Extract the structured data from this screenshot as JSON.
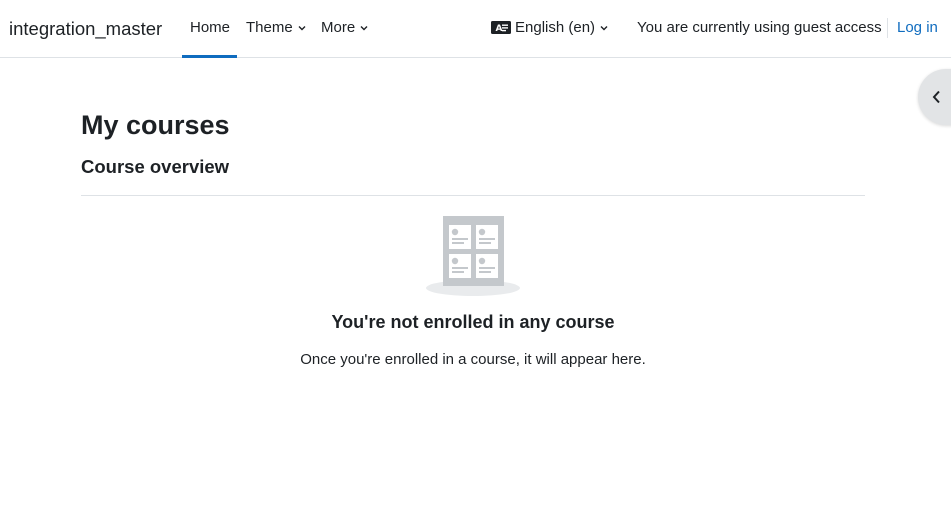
{
  "header": {
    "site_name": "integration_master",
    "nav": {
      "home": "Home",
      "theme": "Theme",
      "more": "More"
    },
    "language": "English (en)",
    "guest_notice": "You are currently using guest access",
    "login": "Log in"
  },
  "main": {
    "page_title": "My courses",
    "section_title": "Course overview",
    "empty_state": {
      "title": "You're not enrolled in any course",
      "text": "Once you're enrolled in a course, it will appear here."
    }
  },
  "icons": {
    "chevron": "chevron-down-icon",
    "language": "language-icon",
    "drawer": "chevron-left-icon",
    "empty": "courses-empty-illustration"
  },
  "colors": {
    "accent": "#0f6cbf",
    "text": "#1d2125",
    "border": "#dee2e6",
    "illustration": "#c4c8cc"
  }
}
